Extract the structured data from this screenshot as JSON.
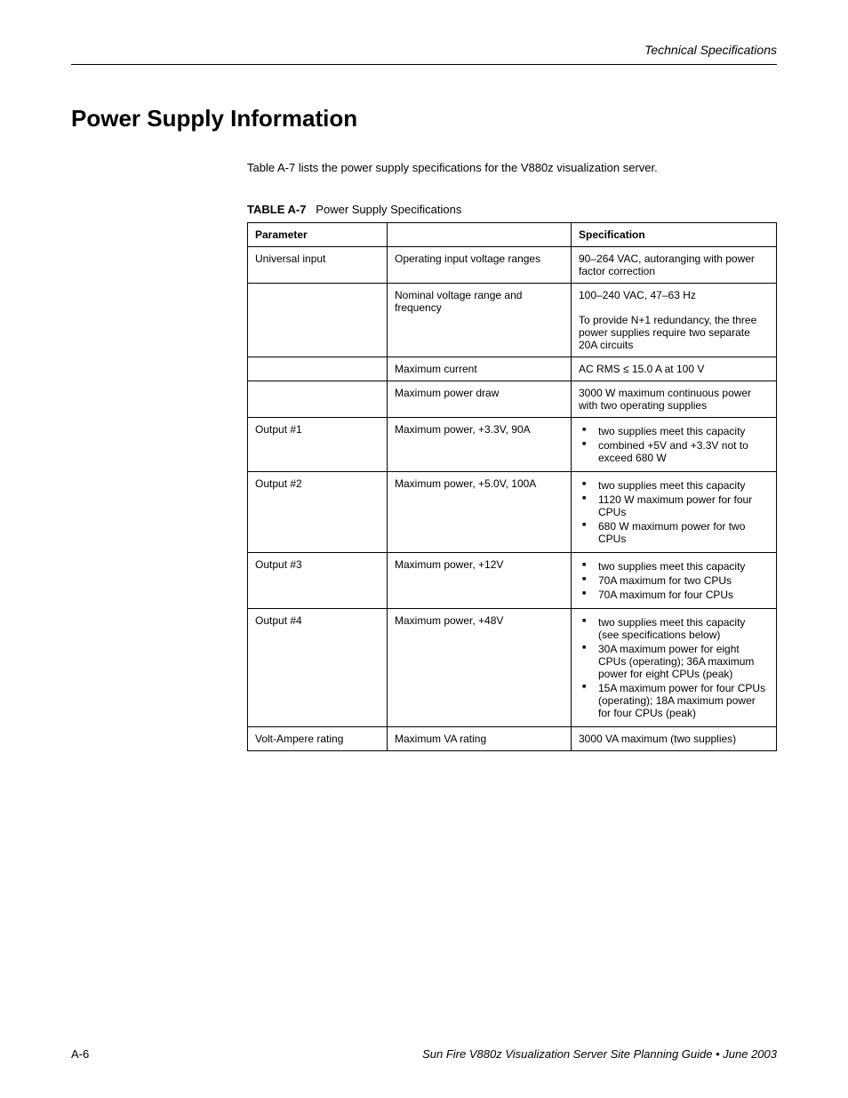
{
  "header": {
    "right": "Technical Specifications"
  },
  "heading": "Power Supply Information",
  "intro": "Table A-7 lists the power supply specifications for the V880z visualization server.",
  "caption_label": "TABLE A-7",
  "caption_text": "Power Supply Specifications",
  "table": {
    "headers": [
      "Parameter",
      "",
      "Specification"
    ],
    "rows": [
      {
        "c1": "Universal input",
        "c2": "Operating input voltage ranges",
        "c3": "90–264 VAC, autoranging with power factor correction"
      },
      {
        "c1": "",
        "c2": "Nominal voltage range and frequency",
        "c3": "100–240 VAC, 47–63 Hz\n\nTo provide N+1 redundancy, the three power supplies require two separate 20A circuits"
      },
      {
        "c1": "",
        "c2": "Maximum current",
        "c3": "AC RMS ≤ 15.0 A at 100 V"
      },
      {
        "c1": "",
        "c2": "Maximum power draw",
        "c3": "3000 W maximum continuous power with two operating supplies"
      },
      {
        "c1": "Output #1",
        "c2": "Maximum power, +3.3V, 90A",
        "bullets": [
          "two supplies meet this capacity",
          "combined +5V and +3.3V not to exceed 680 W"
        ]
      },
      {
        "c1": "Output #2",
        "c2": "Maximum power, +5.0V, 100A",
        "bullets": [
          "two supplies meet this capacity",
          "1120 W maximum power for four CPUs",
          "680 W maximum power for two CPUs"
        ]
      },
      {
        "c1": "Output #3",
        "c2": "Maximum power, +12V",
        "bullets": [
          "two supplies meet this capacity",
          "70A maximum for two CPUs",
          "70A maximum for four CPUs"
        ]
      },
      {
        "c1": "Output #4",
        "c2": "Maximum power, +48V",
        "bullets": [
          "two supplies meet this capacity (see specifications below)",
          "30A maximum power for eight CPUs (operating); 36A maximum power for eight CPUs (peak)",
          "15A maximum power for four CPUs (operating); 18A maximum power for four CPUs (peak)"
        ]
      },
      {
        "c1": "Volt-Ampere rating",
        "c2": "Maximum VA rating",
        "c3": "3000 VA maximum (two supplies)"
      }
    ]
  },
  "footer": {
    "left": "A-6",
    "right": "Sun Fire V880z Visualization Server Site Planning Guide • June 2003"
  }
}
